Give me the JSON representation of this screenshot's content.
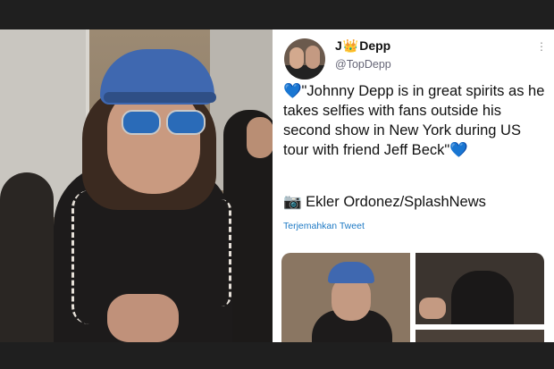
{
  "tweet": {
    "name_prefix": "J",
    "name_suffix": "Depp",
    "handle": "@TopDepp",
    "more": "⋮",
    "text": "\"Johnny Depp is in great spirits as he takes selfies with fans outside his second show in New York during US tour with friend Jeff Beck\"",
    "heart": "💙",
    "camera": "📷",
    "credit": "Ekler Ordonez/SplashNews",
    "translate_label": "Terjemahkan Tweet"
  },
  "colors": {
    "heart": "#3d8de6",
    "link": "#1d79c4",
    "background": "#1f1f1f"
  }
}
